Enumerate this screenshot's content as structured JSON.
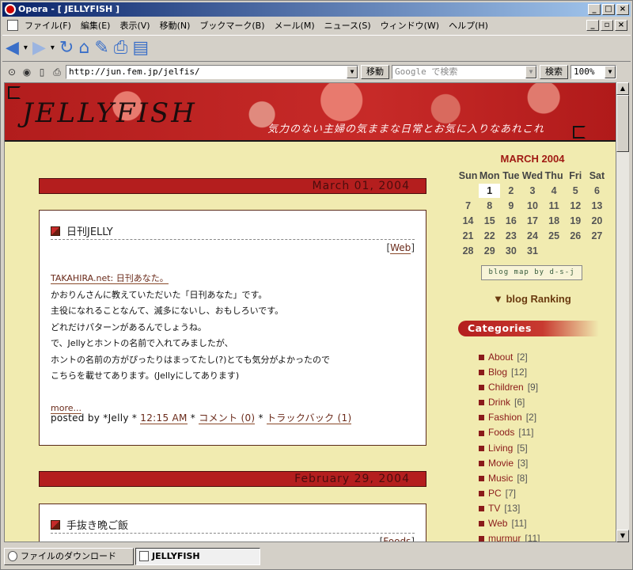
{
  "window": {
    "title": "Opera - [ JELLYFISH ]"
  },
  "menu": [
    "ファイル(F)",
    "編集(E)",
    "表示(V)",
    "移動(N)",
    "ブックマーク(B)",
    "メール(M)",
    "ニュース(S)",
    "ウィンドウ(W)",
    "ヘルプ(H)"
  ],
  "address": {
    "url": "http://jun.fem.jp/jelfis/",
    "go": "移動",
    "search_placeholder": "Google で検索",
    "search": "検索",
    "zoom": "100%"
  },
  "banner": {
    "title": "JELLYFISH",
    "subtitle": "気力のない主婦の気ままな日常とお気に入りなあれこれ"
  },
  "posts": [
    {
      "date": "March 01, 2004",
      "title": "日刊JELLY",
      "category": "Web",
      "link": "TAKAHIRA.net: 日刊あなた。",
      "lines": [
        "かおりんさんに教えていただいた「日刊あなた」です。",
        "主役になれることなんて、滅多にないし、おもしろいです。",
        "どれだけパターンがあるんでしょうね。",
        "で、Jellyとホントの名前で入れてみましたが、",
        "ホントの名前の方がぴったりはまってたし(?)とても気分がよかったので",
        "こちらを載せてあります。(Jellyにしてあります)"
      ],
      "more": "more...",
      "posted_by": "posted by *Jelly *",
      "time": "12:15 AM",
      "comments": "コメント (0)",
      "trackback": "トラックバック (1)"
    },
    {
      "date": "February 29, 2004",
      "title": "手抜き晩ご飯",
      "category": "Foods"
    }
  ],
  "calendar": {
    "title": "MARCH 2004",
    "days": [
      "Sun",
      "Mon",
      "Tue",
      "Wed",
      "Thu",
      "Fri",
      "Sat"
    ],
    "cells": [
      "",
      "1",
      "2",
      "3",
      "4",
      "5",
      "6",
      "7",
      "8",
      "9",
      "10",
      "11",
      "12",
      "13",
      "14",
      "15",
      "16",
      "17",
      "18",
      "19",
      "20",
      "21",
      "22",
      "23",
      "24",
      "25",
      "26",
      "27",
      "28",
      "29",
      "30",
      "31",
      "",
      "",
      ""
    ],
    "today": "1"
  },
  "blogmap": "blog map by d-s-j",
  "ranking": "▼ blog Ranking",
  "categories_title": "Categories",
  "categories": [
    {
      "name": "About",
      "count": "[2]"
    },
    {
      "name": "Blog",
      "count": "[12]"
    },
    {
      "name": "Children",
      "count": "[9]"
    },
    {
      "name": "Drink",
      "count": "[6]"
    },
    {
      "name": "Fashion",
      "count": "[2]"
    },
    {
      "name": "Foods",
      "count": "[11]"
    },
    {
      "name": "Living",
      "count": "[5]"
    },
    {
      "name": "Movie",
      "count": "[3]"
    },
    {
      "name": "Music",
      "count": "[8]"
    },
    {
      "name": "PC",
      "count": "[7]"
    },
    {
      "name": "TV",
      "count": "[13]"
    },
    {
      "name": "Web",
      "count": "[11]"
    },
    {
      "name": "murmur",
      "count": "[11]"
    }
  ],
  "status": {
    "downloads": "ファイルのダウンロード",
    "tab": "JELLYFISH"
  }
}
